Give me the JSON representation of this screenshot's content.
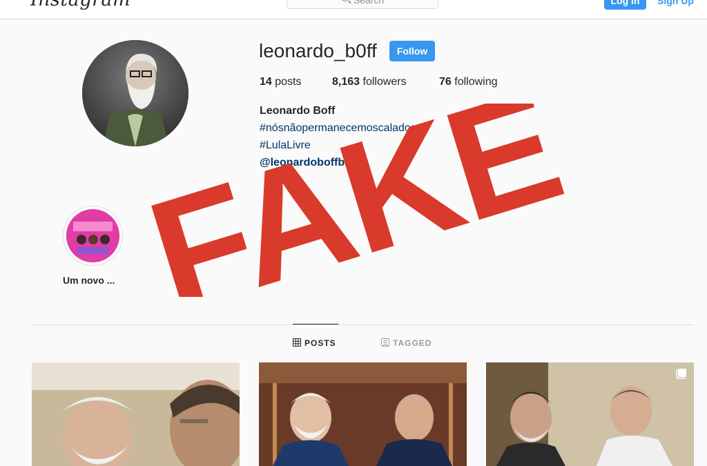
{
  "header": {
    "logo": "Instagram",
    "search_placeholder": "Search",
    "login_label": "Log In",
    "signup_label": "Sign Up"
  },
  "profile": {
    "username": "leonardo_b0ff",
    "follow_label": "Follow",
    "stats": {
      "posts_count": "14",
      "posts_label": "posts",
      "followers_count": "8,163",
      "followers_label": "followers",
      "following_count": "76",
      "following_label": "following"
    },
    "full_name": "Leonardo Boff",
    "bio_lines": [
      "#nósnãopermanecemoscalados",
      "#LulaLivre",
      "@leonardoboffblog"
    ]
  },
  "highlights": [
    {
      "label": "Um novo ..."
    }
  ],
  "tabs": [
    {
      "label": "POSTS",
      "icon": "grid-icon",
      "active": true
    },
    {
      "label": "TAGGED",
      "icon": "tagged-icon",
      "active": false
    }
  ],
  "posts": [
    {
      "icon": "photo-icon"
    },
    {
      "icon": "photo-icon"
    },
    {
      "icon": "photo-icon",
      "multi": true
    }
  ],
  "overlay": {
    "stamp_text": "FAKE",
    "stamp_color": "#d93a2b"
  },
  "colors": {
    "accent": "#3897f0",
    "link": "#003569",
    "text": "#262626",
    "background": "#fafafa"
  }
}
